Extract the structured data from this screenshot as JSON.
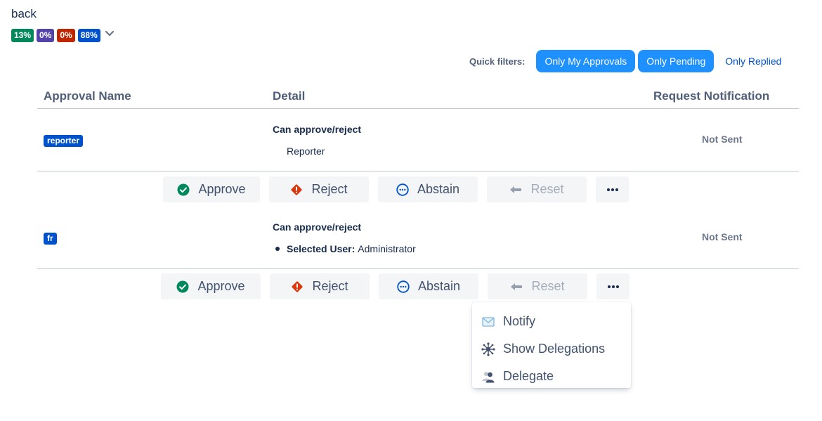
{
  "nav": {
    "back_label": "back"
  },
  "progress_badges": [
    {
      "label": "13%",
      "color": "#00875a"
    },
    {
      "label": "0%",
      "color": "#5243aa"
    },
    {
      "label": "0%",
      "color": "#bf2600"
    },
    {
      "label": "88%",
      "color": "#0052cc"
    }
  ],
  "quick_filters": {
    "label": "Quick filters:",
    "buttons": [
      {
        "label": "Only My Approvals",
        "active": true
      },
      {
        "label": "Only Pending",
        "active": true
      },
      {
        "label": "Only Replied",
        "active": false
      }
    ]
  },
  "table": {
    "headers": {
      "name": "Approval Name",
      "detail": "Detail",
      "notification": "Request Notification"
    },
    "rows": [
      {
        "name": "reporter",
        "detail_title": "Can approve/reject",
        "detail_text": "Reporter",
        "notification": "Not Sent"
      },
      {
        "name": "fr",
        "detail_title": "Can approve/reject",
        "detail_key": "Selected User:",
        "detail_value": "Administrator",
        "notification": "Not Sent"
      }
    ]
  },
  "actions": {
    "approve": "Approve",
    "reject": "Reject",
    "abstain": "Abstain",
    "reset": "Reset",
    "more": "•••"
  },
  "more_menu": {
    "items": [
      {
        "label": "Notify",
        "icon": "envelope-icon"
      },
      {
        "label": "Show Delegations",
        "icon": "network-icon"
      },
      {
        "label": "Delegate",
        "icon": "users-icon"
      }
    ]
  },
  "colors": {
    "accent": "#1e90ff",
    "link": "#0052cc",
    "approve": "#00875a",
    "reject": "#de350b",
    "abstain": "#0052cc"
  }
}
